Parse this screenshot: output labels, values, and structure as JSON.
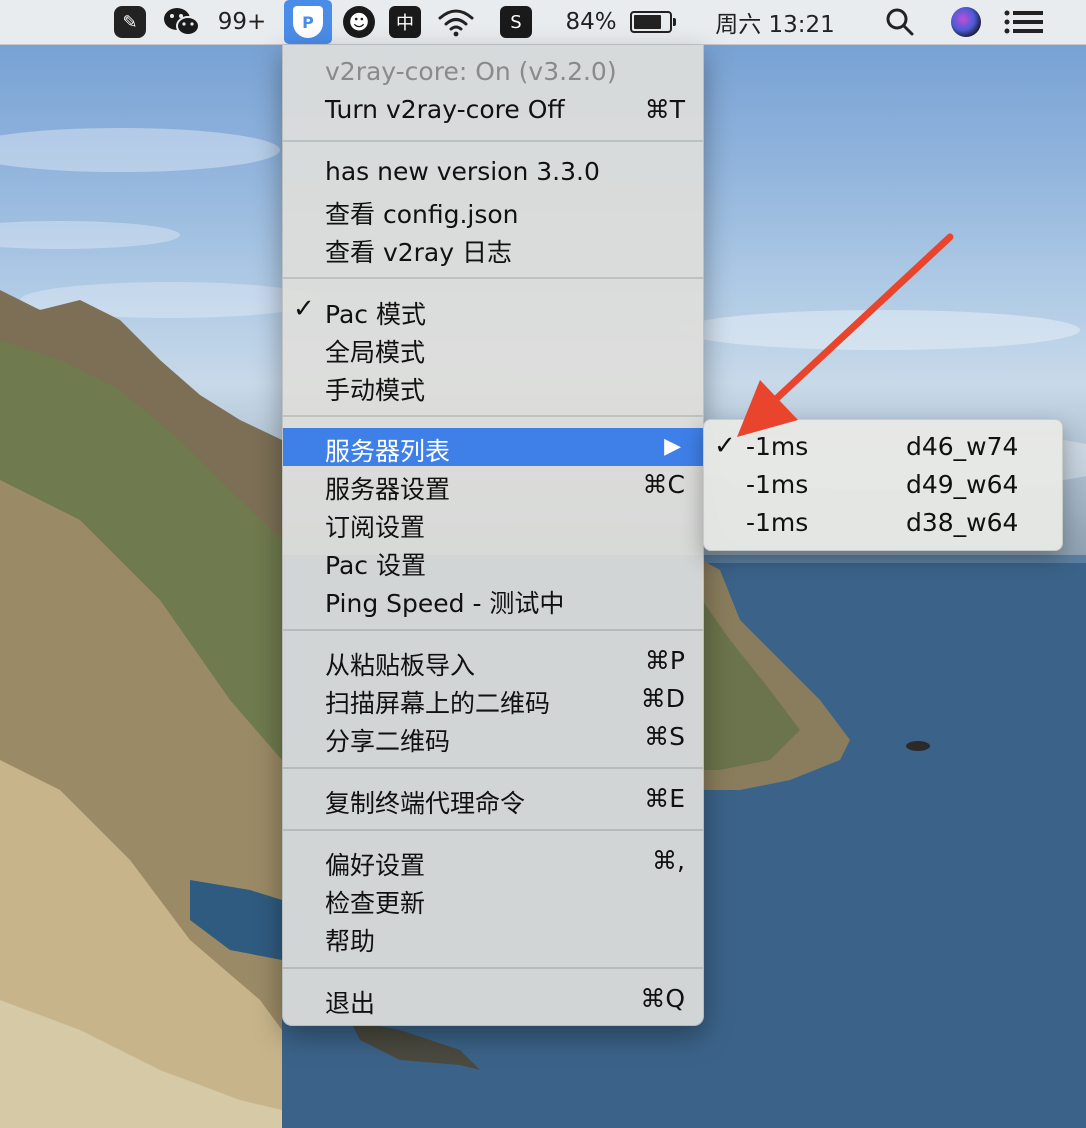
{
  "menubar": {
    "items": [
      {
        "icon": "note-app-icon"
      },
      {
        "icon": "wechat-icon"
      },
      {
        "label": "99+"
      },
      {
        "icon": "v2rayu-icon",
        "active": true,
        "symbol": "P"
      },
      {
        "icon": "smiley-icon",
        "symbol": "☻"
      },
      {
        "icon": "input-method-icon",
        "symbol": "中"
      },
      {
        "icon": "wifi-icon"
      },
      {
        "icon": "sogou-icon",
        "symbol": "S"
      },
      {
        "label": "84%"
      },
      {
        "icon": "battery-icon",
        "level": 0.84
      },
      {
        "label": "周六 13:21"
      },
      {
        "icon": "search-icon"
      },
      {
        "icon": "siri-icon"
      },
      {
        "icon": "notification-center-icon"
      }
    ]
  },
  "menu": {
    "status": "v2ray-core: On  (v3.2.0)",
    "toggle": {
      "label": "Turn v2ray-core Off",
      "shortcut": "⌘T"
    },
    "new_version": "has new version 3.3.0",
    "view_config": "查看 config.json",
    "view_log": "查看 v2ray 日志",
    "modes": [
      {
        "label": "Pac 模式",
        "checked": true
      },
      {
        "label": "全局模式",
        "checked": false
      },
      {
        "label": "手动模式",
        "checked": false
      }
    ],
    "server_list": {
      "label": "服务器列表",
      "arrow": "▶"
    },
    "server_settings": {
      "label": "服务器设置",
      "shortcut": "⌘C"
    },
    "subscription": "订阅设置",
    "pac_settings": "Pac 设置",
    "ping_speed": "Ping Speed - 测试中",
    "import_clipboard": {
      "label": "从粘贴板导入",
      "shortcut": "⌘P"
    },
    "scan_qr": {
      "label": "扫描屏幕上的二维码",
      "shortcut": "⌘D"
    },
    "share_qr": {
      "label": "分享二维码",
      "shortcut": "⌘S"
    },
    "copy_proxy": {
      "label": "复制终端代理命令",
      "shortcut": "⌘E"
    },
    "preferences": {
      "label": "偏好设置",
      "shortcut": "⌘,"
    },
    "check_updates": "检查更新",
    "help": "帮助",
    "quit": {
      "label": "退出",
      "shortcut": "⌘Q"
    },
    "check_symbol": "✓"
  },
  "submenu": {
    "servers": [
      {
        "latency": "-1ms",
        "name": "d46_w74",
        "checked": true
      },
      {
        "latency": "-1ms",
        "name": "d49_w64",
        "checked": false
      },
      {
        "latency": "-1ms",
        "name": "d38_w64",
        "checked": false
      }
    ]
  },
  "annotation": {
    "color": "#e8452c"
  }
}
